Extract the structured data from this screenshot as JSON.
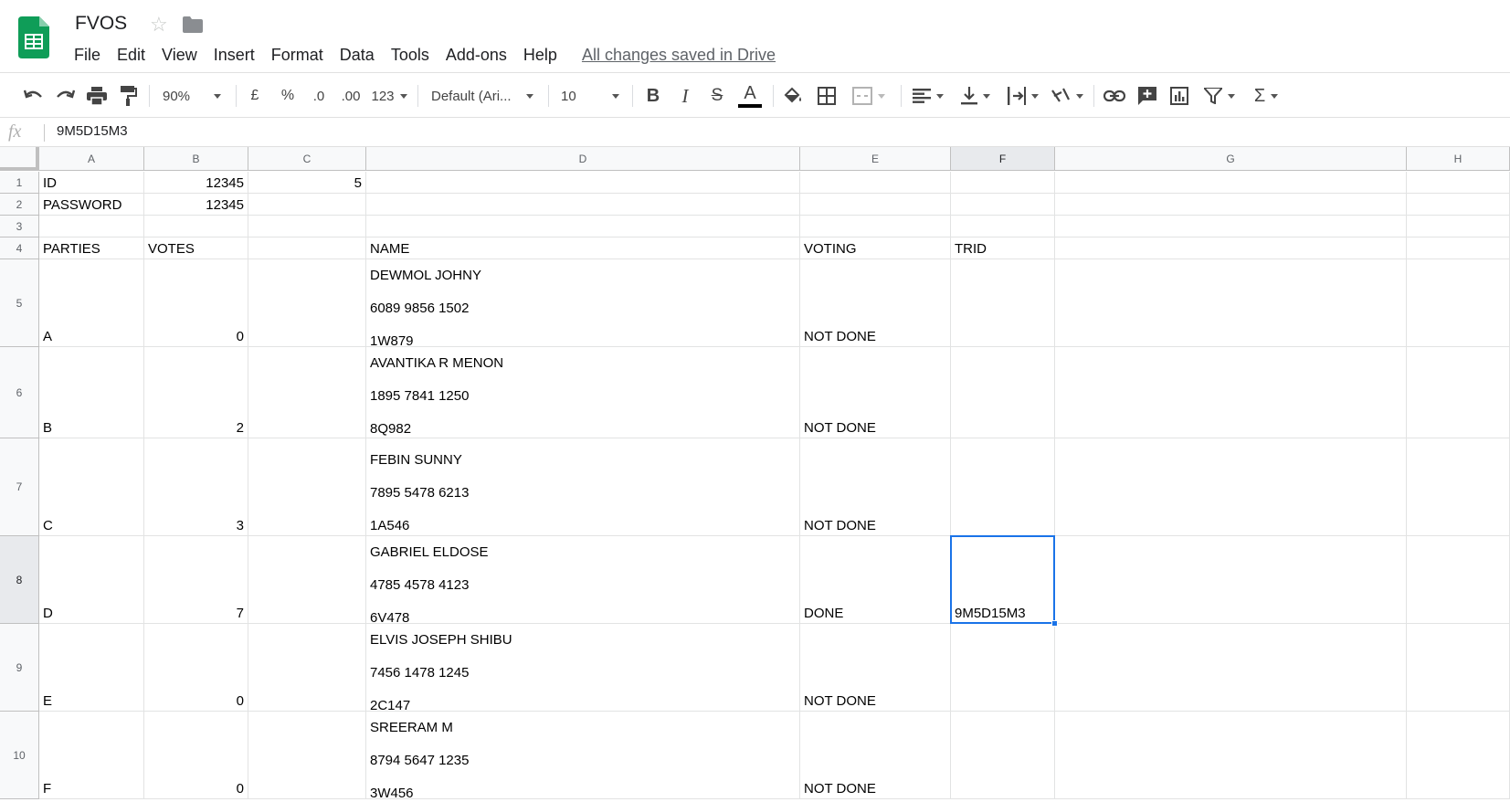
{
  "document": {
    "title": "FVOS",
    "save_status": "All changes saved in Drive"
  },
  "menu": [
    "File",
    "Edit",
    "View",
    "Insert",
    "Format",
    "Data",
    "Tools",
    "Add-ons",
    "Help"
  ],
  "toolbar": {
    "zoom": "90%",
    "currency": "£",
    "percent": "%",
    "decrease_decimal": ".0",
    "increase_decimal": ".00",
    "more_formats": "123",
    "font": "Default (Ari...",
    "font_size": "10",
    "bold": "B",
    "italic": "I",
    "strikethrough": "S",
    "text_color_letter": "A",
    "text_color": "#000000",
    "functions": "Σ"
  },
  "formula_bar": {
    "fx": "fx",
    "value": "9M5D15M3"
  },
  "grid": {
    "columns": [
      "A",
      "B",
      "C",
      "D",
      "E",
      "F",
      "G",
      "H"
    ],
    "rows": [
      "1",
      "2",
      "3",
      "4",
      "5",
      "6",
      "7",
      "8",
      "9",
      "10"
    ],
    "selected_cell": "F8",
    "cells": {
      "A1": "ID",
      "B1": "12345",
      "C1": "5",
      "A2": "PASSWORD",
      "B2": "12345",
      "A4": "PARTIES",
      "B4": "VOTES",
      "D4": "NAME",
      "E4": "VOTING",
      "F4": "TRID",
      "A5": "A",
      "B5": "0",
      "D5": "DEWMOL JOHNY\n6089 9856 1502\n1W879",
      "E5": "NOT DONE",
      "A6": "B",
      "B6": "2",
      "D6": "AVANTIKA R MENON\n1895 7841 1250\n8Q982",
      "E6": "NOT DONE",
      "A7": "C",
      "B7": "3",
      "D7": "FEBIN SUNNY\n7895 5478 6213\n1A546",
      "E7": "NOT DONE",
      "A8": "D",
      "B8": "7",
      "D8": "GABRIEL ELDOSE\n4785 4578 4123\n6V478",
      "E8": "DONE",
      "F8": "9M5D15M3",
      "A9": "E",
      "B9": "0",
      "D9": "ELVIS JOSEPH SHIBU\n7456 1478 1245\n2C147",
      "E9": "NOT DONE",
      "A10": "F",
      "B10": "0",
      "D10": "SREERAM M\n8794 5647 1235\n3W456",
      "E10": "NOT DONE"
    }
  },
  "colors": {
    "accent": "#1a73e8",
    "sheets_green": "#0f9d58"
  }
}
